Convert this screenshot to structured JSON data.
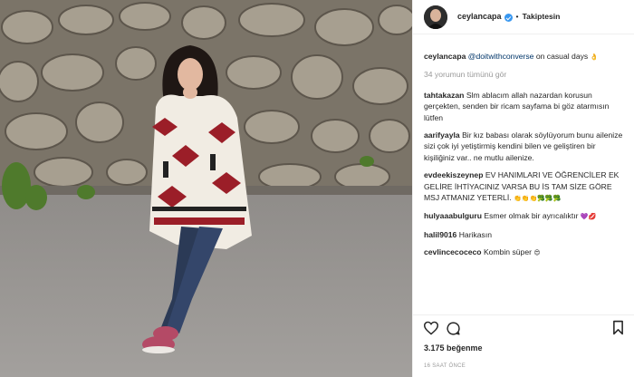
{
  "post": {
    "username": "ceylancapa",
    "follow_label": "Takiptesin",
    "dot": "•",
    "caption": {
      "user": "ceylancapa",
      "mention": "@doitwithconverse",
      "text": "on casual days",
      "emoji": "👌"
    },
    "view_comments": "34 yorumun tümünü gör",
    "comments": [
      {
        "user": "tahtakazan",
        "text": "Slm ablacım allah nazardan korusun gerçekten, senden bir ricam sayfama bi göz atarmısın lütfen"
      },
      {
        "user": "aarifyayla",
        "text": "Bir kız babası olarak söylüyorum bunu ailenize sizi çok iyi yetiştirmiş kendini bilen ve geliştiren bir kişiliğiniz var.. ne mutlu ailenize."
      },
      {
        "user": "evdeekiszeynep",
        "text": "EV HANIMLARI VE ÖĞRENCİLER EK GELİRE İHTİYACINIZ VARSA BU İS TAM SİZE GÖRE MSJ ATMANIZ YETERLİ.",
        "emoji": "👏👏👏🥦🥦🥦"
      },
      {
        "user": "hulyaaabulguru",
        "text": "Esmer olmak bir ayrıcalıktır",
        "emoji": "💜💋"
      },
      {
        "user": "halil9016",
        "text": "Harikasın"
      },
      {
        "user": "cevlincecoceco",
        "text": "Kombin süper",
        "emoji": "😍"
      }
    ],
    "likes": "3.175 beğenme",
    "time": "16 SAAT ÖNCE"
  },
  "icons": {
    "like": "heart-icon",
    "comment": "comment-icon",
    "save": "bookmark-icon",
    "verified": "verified-badge-icon"
  },
  "colors": {
    "link": "#003569",
    "muted": "#999999",
    "verified": "#3897f0"
  }
}
